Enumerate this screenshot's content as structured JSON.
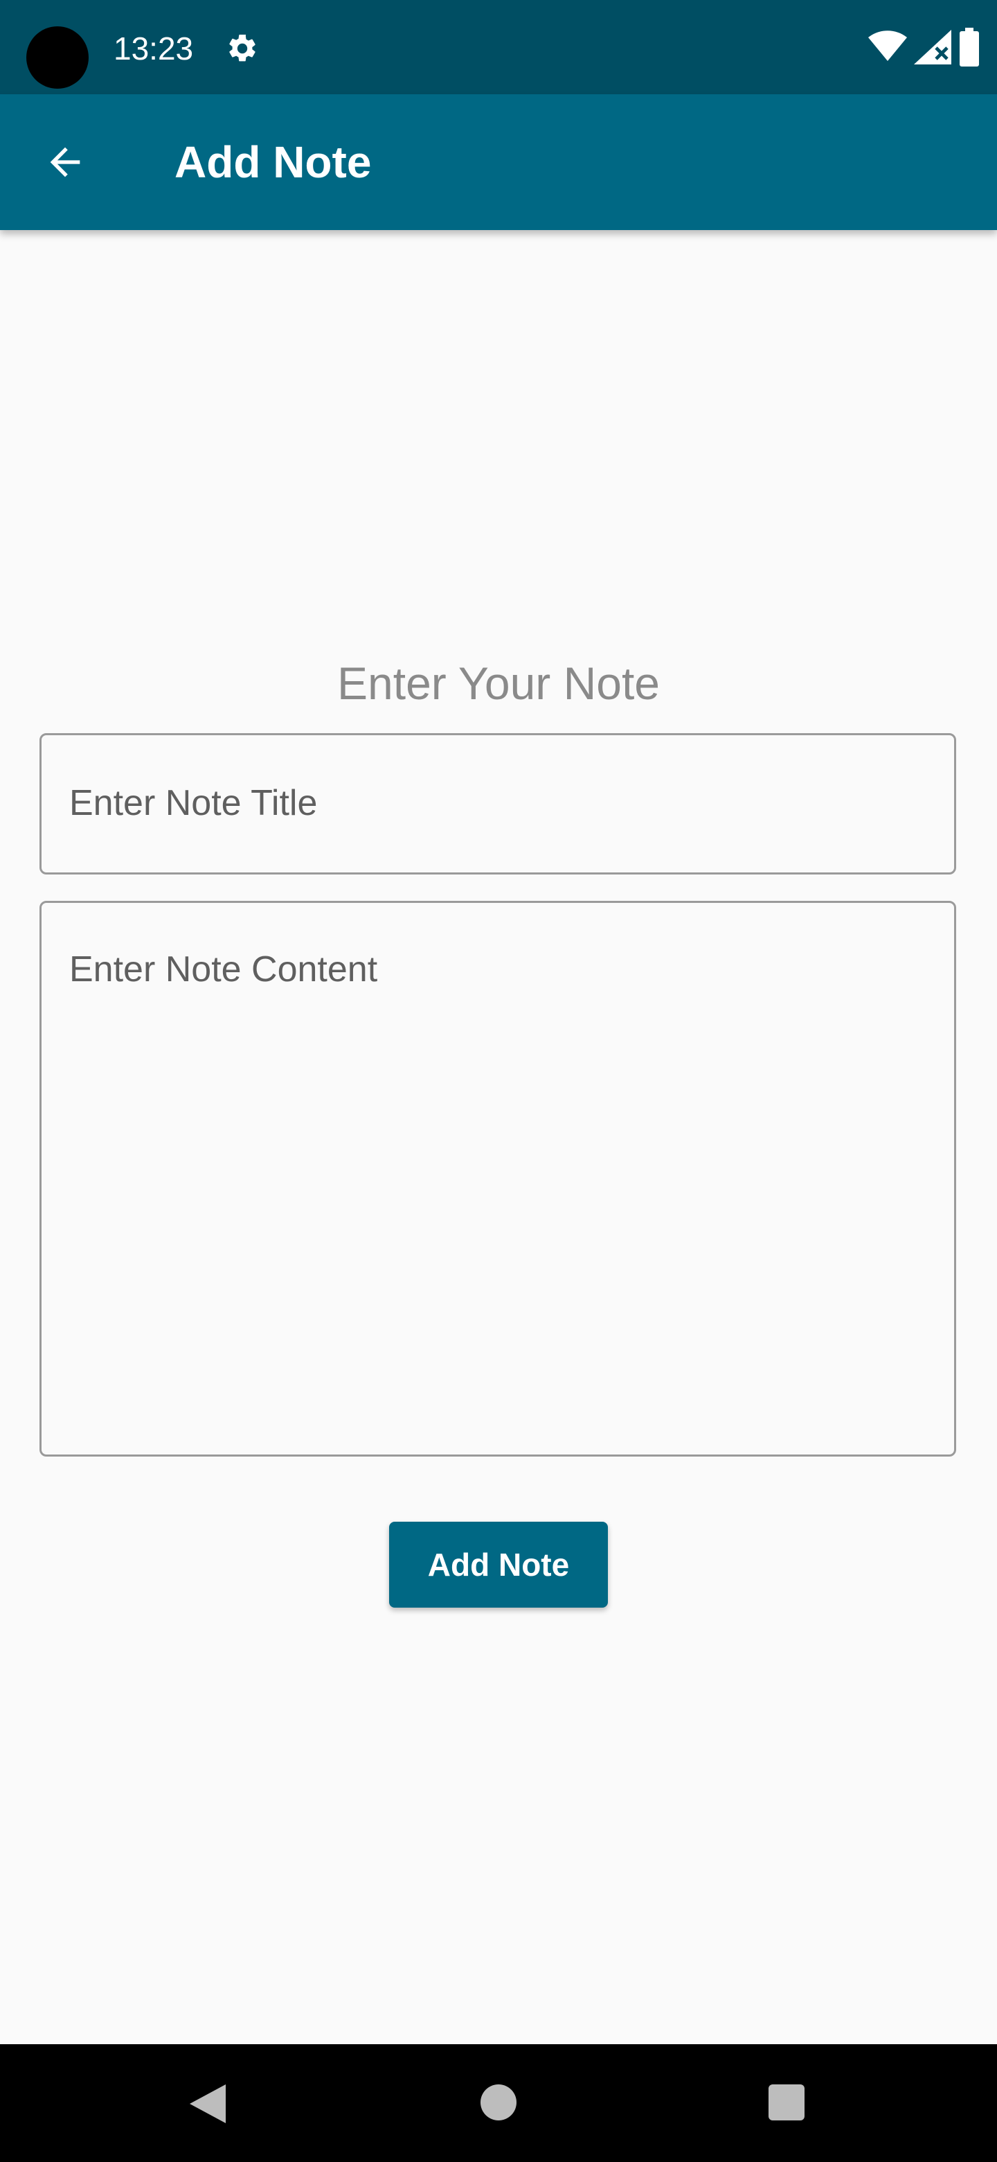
{
  "status_bar": {
    "time": "13:23",
    "icons": [
      "camera-dot",
      "gear-icon",
      "wifi-icon",
      "signal-icon",
      "battery-icon"
    ]
  },
  "app_bar": {
    "title": "Add Note",
    "back_icon": "arrow-left-icon"
  },
  "form": {
    "heading": "Enter Your Note",
    "title_placeholder": "Enter Note Title",
    "content_placeholder": "Enter Note Content",
    "submit_label": "Add Note"
  },
  "nav_bar": {
    "icons": [
      "back-triangle-icon",
      "home-circle-icon",
      "recents-square-icon"
    ]
  },
  "colors": {
    "status_bar": "#004e63",
    "app_bar": "#006884",
    "button": "#006884",
    "background": "#fafafa"
  }
}
